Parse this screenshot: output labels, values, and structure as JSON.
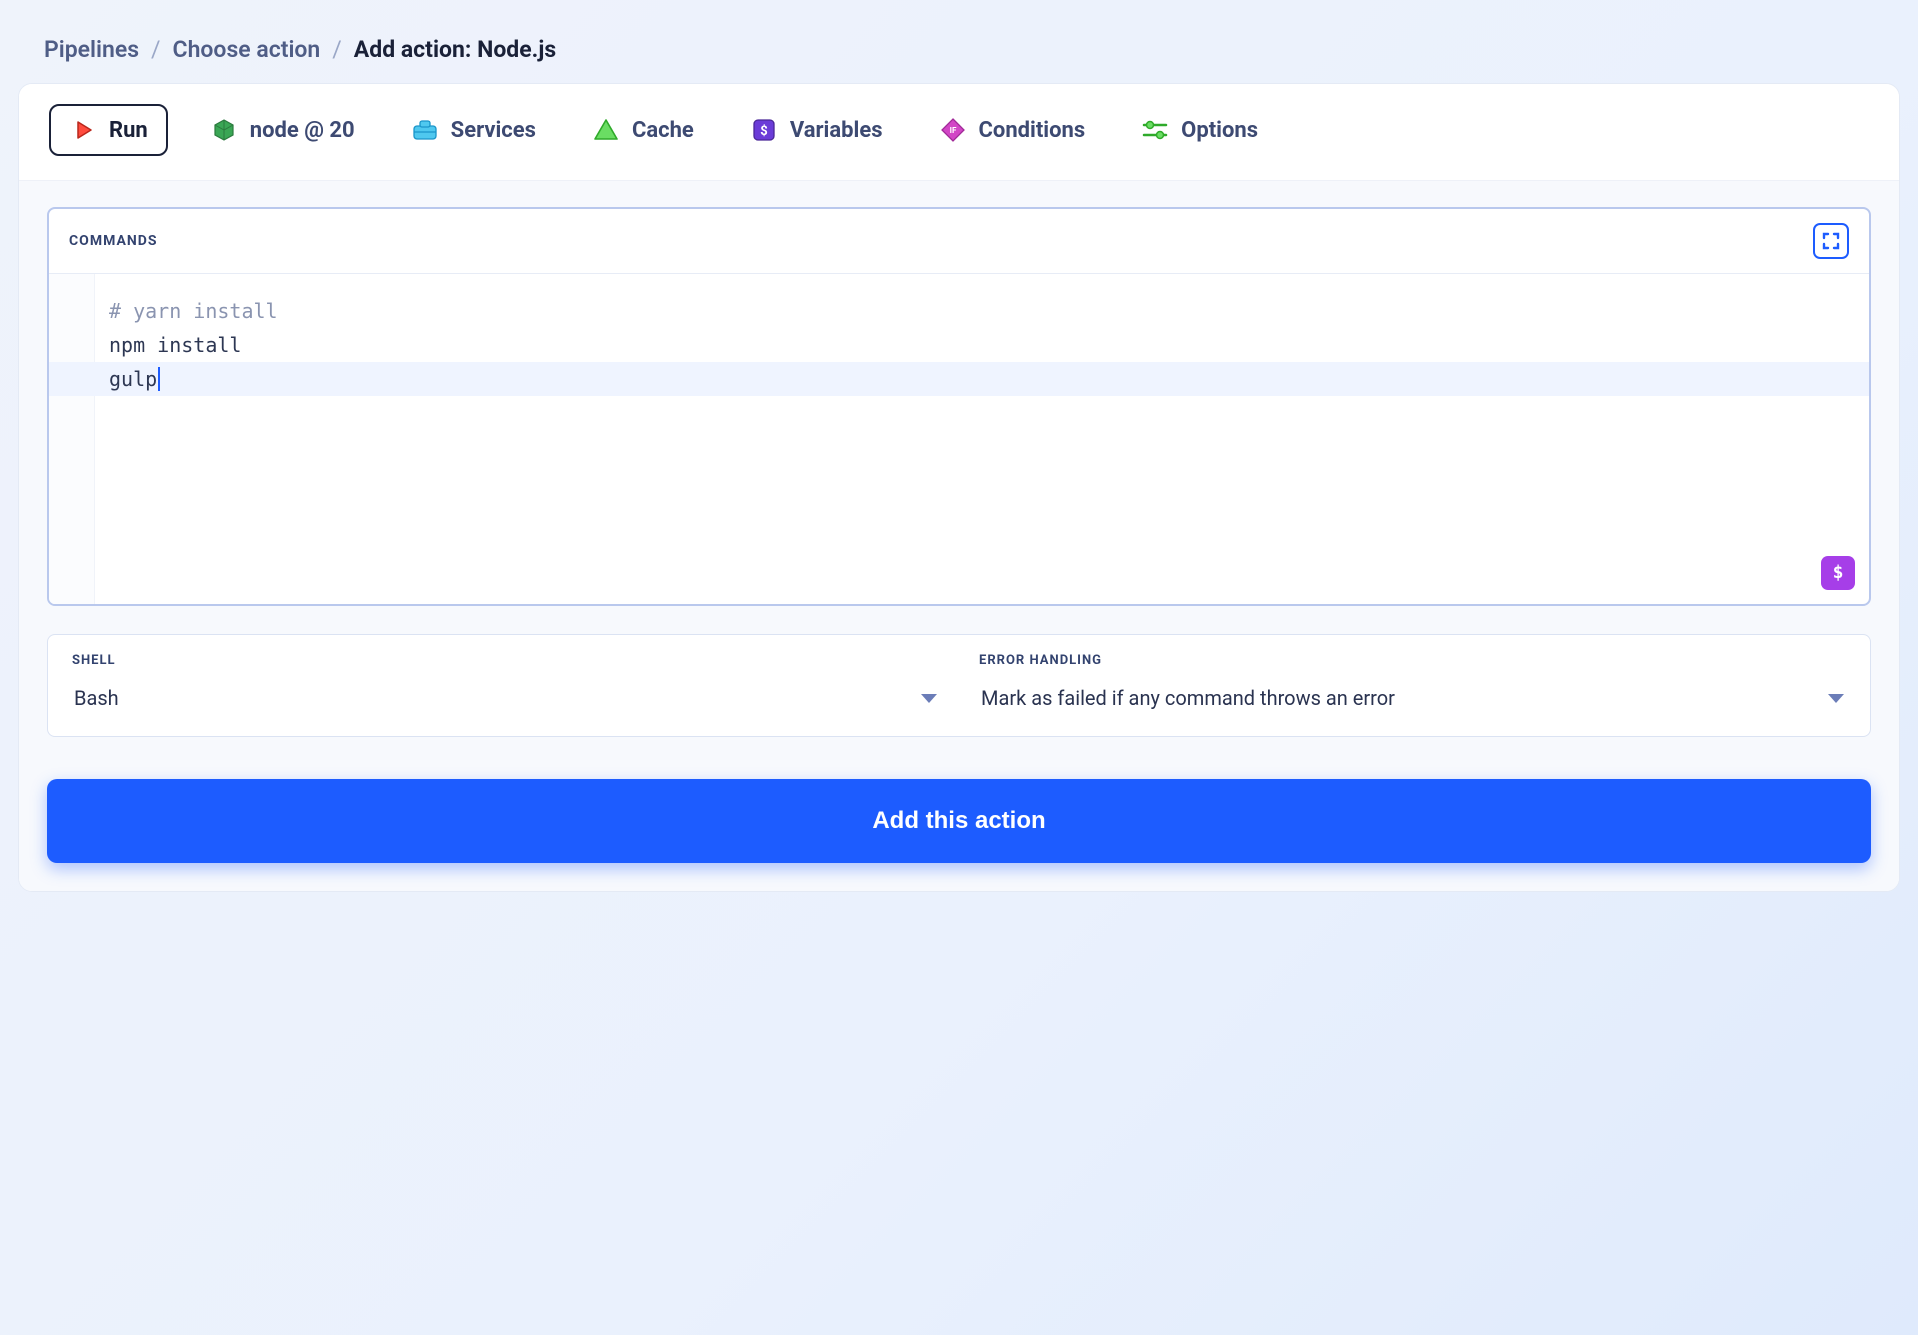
{
  "breadcrumb": {
    "items": [
      "Pipelines",
      "Choose action"
    ],
    "current": "Add action: Node.js"
  },
  "tabs": {
    "run": "Run",
    "node": "node @ 20",
    "services": "Services",
    "cache": "Cache",
    "variables": "Variables",
    "conditions": "Conditions",
    "options": "Options"
  },
  "editor": {
    "title": "Commands",
    "lines": [
      {
        "text": "# yarn install",
        "type": "comment"
      },
      {
        "text": "npm install",
        "type": "code"
      },
      {
        "text": "gulp",
        "type": "code",
        "current": true
      }
    ],
    "var_button": "$"
  },
  "settings": {
    "shell": {
      "label": "Shell",
      "value": "Bash"
    },
    "error": {
      "label": "Error Handling",
      "value": "Mark as failed if any command throws an error"
    }
  },
  "primary_button": "Add this action"
}
